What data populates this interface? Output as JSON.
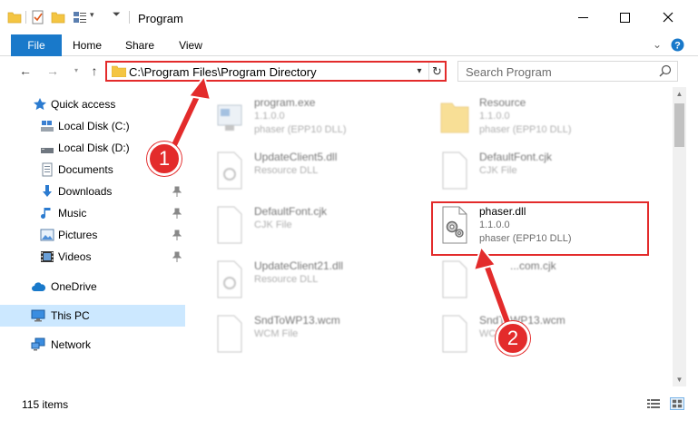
{
  "window": {
    "title": "Program",
    "minimize_icon": "minimize-icon",
    "maximize_icon": "maximize-icon",
    "close_icon": "close-icon"
  },
  "ribbon": {
    "tabs": [
      {
        "label": "File"
      },
      {
        "label": "Home"
      },
      {
        "label": "Share"
      },
      {
        "label": "View"
      }
    ],
    "accent_color": "#1979ca"
  },
  "address": {
    "path": "C:\\Program Files\\Program Directory",
    "search_placeholder": "Search Program"
  },
  "nav": {
    "items": [
      {
        "label": "Quick access",
        "icon": "star-icon"
      },
      {
        "label": "Local Disk (C:)",
        "icon": "drive-icon"
      },
      {
        "label": "Local Disk (D:)",
        "icon": "drive-icon"
      },
      {
        "label": "Documents",
        "icon": "documents-icon"
      },
      {
        "label": "Downloads",
        "icon": "download-icon"
      },
      {
        "label": "Music",
        "icon": "music-icon"
      },
      {
        "label": "Pictures",
        "icon": "pictures-icon"
      },
      {
        "label": "Videos",
        "icon": "videos-icon"
      },
      {
        "label": "OneDrive",
        "icon": "cloud-icon"
      },
      {
        "label": "This PC",
        "icon": "computer-icon"
      },
      {
        "label": "Network",
        "icon": "network-icon"
      }
    ]
  },
  "files": [
    {
      "name": "program.exe",
      "line1": "1.1.0.0",
      "line2": "phaser (EPP10 DLL)"
    },
    {
      "name": "Resource",
      "line1": "1.1.0.0",
      "line2": "phaser (EPP10 DLL)"
    },
    {
      "name": "UpdateClient5.dll",
      "line1": "Resource DLL",
      "line2": ""
    },
    {
      "name": "DefaultFont.cjk",
      "line1": "CJK File",
      "line2": ""
    },
    {
      "name": "DefaultFont.cjk",
      "line1": "CJK File",
      "line2": ""
    },
    {
      "name": "phaser.dll",
      "line1": "1.1.0.0",
      "line2": "phaser (EPP10 DLL)"
    },
    {
      "name": "UpdateClient21.dll",
      "line1": "Resource DLL",
      "line2": ""
    },
    {
      "name": "...com.cjk",
      "line1": "",
      "line2": ""
    },
    {
      "name": "SndToWP13.wcm",
      "line1": "WCM File",
      "line2": ""
    },
    {
      "name": "SndToWP13.wcm",
      "line1": "WCM File",
      "line2": ""
    }
  ],
  "status": {
    "items_count": "115 items"
  },
  "callouts": {
    "step1": "1",
    "step2": "2",
    "color": "#e32b2b"
  }
}
